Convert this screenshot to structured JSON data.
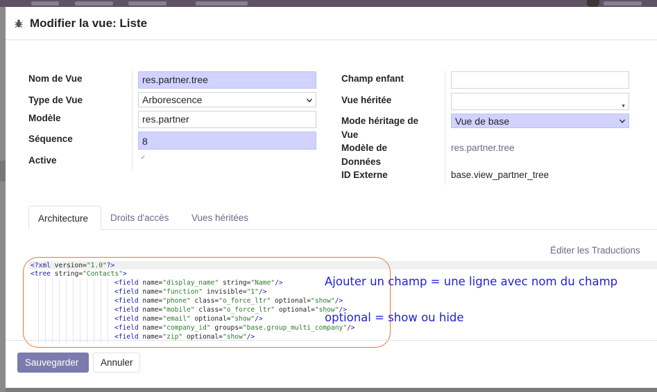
{
  "modal": {
    "title": "Modifier la vue: Liste"
  },
  "form_left": {
    "name_label": "Nom de Vue",
    "name_value": "res.partner.tree",
    "type_label": "Type de Vue",
    "type_value": "Arborescence",
    "model_label": "Modèle",
    "model_value": "res.partner",
    "sequence_label": "Séquence",
    "sequence_value": "8",
    "active_label": "Active",
    "active_checked": true
  },
  "form_right": {
    "child_field_label": "Champ enfant",
    "child_field_value": "",
    "inherited_view_label": "Vue héritée",
    "inherited_view_value": "",
    "inherit_mode_label_1": "Mode héritage de",
    "inherit_mode_label_2": "Vue",
    "inherit_mode_value": "Vue de base",
    "data_model_label_1": "Modèle de",
    "data_model_label_2": "Données",
    "data_model_value": "res.partner.tree",
    "external_id_label": "ID Externe",
    "external_id_value": "base.view_partner_tree"
  },
  "tabs": [
    {
      "label": "Architecture",
      "active": true
    },
    {
      "label": "Droits d'accès",
      "active": false
    },
    {
      "label": "Vues héritées",
      "active": false
    }
  ],
  "edit_translations": "Éditer les Traductions",
  "code_lines": [
    "<?xml version=\"1.0\"?>",
    "<tree string=\"Contacts\">",
    "<field name=\"display_name\" string=\"Name\"/>",
    "<field name=\"function\" invisible=\"1\"/>",
    "<field name=\"phone\" class=\"o_force_ltr\" optional=\"show\"/>",
    "<field name=\"mobile\" class=\"o_force_ltr\" optional=\"show\"/>",
    "<field name=\"email\" optional=\"show\"/>",
    "<field name=\"company_id\" groups=\"base.group_multi_company\"/>",
    "<field name=\"zip\" optional=\"show\"/>"
  ],
  "annotations": {
    "line1": "Ajouter un champ = une ligne avec nom du champ",
    "line2": "optional = show ou hide"
  },
  "buttons": {
    "save": "Sauvegarder",
    "cancel": "Annuler"
  },
  "colors": {
    "primary": "#7c7bad",
    "required_field": "#d2d2ff",
    "annotation_text": "#1f1fd6",
    "annotation_oval": "#e8782a"
  }
}
